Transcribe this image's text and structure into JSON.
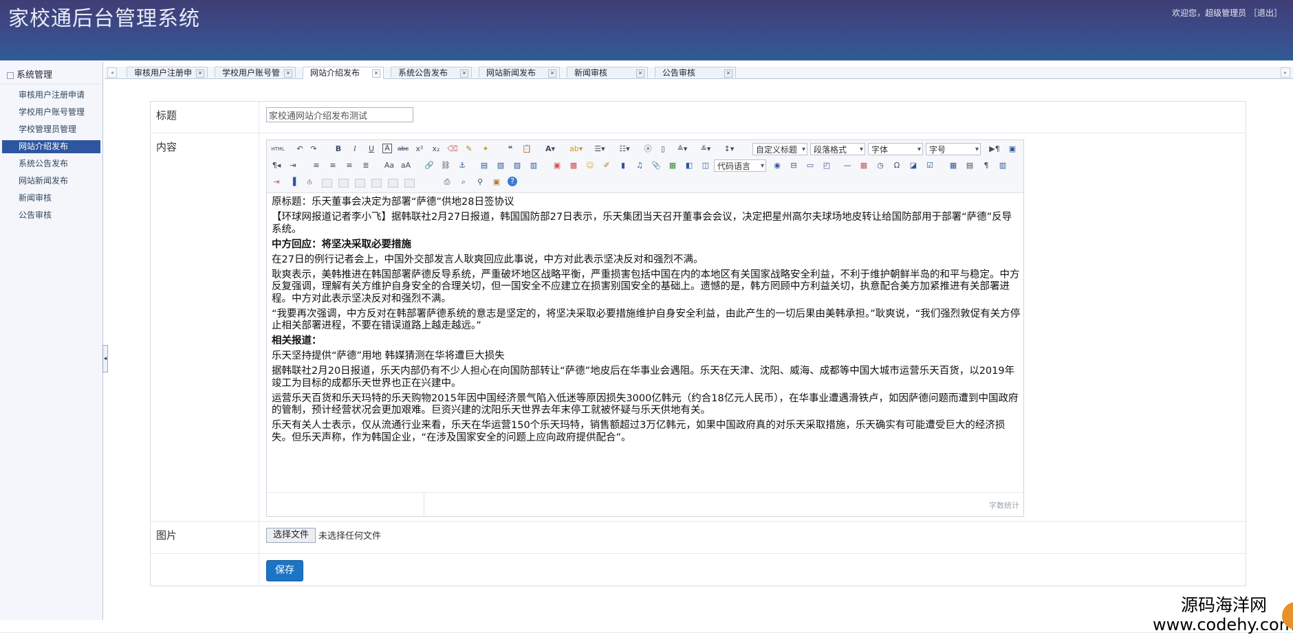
{
  "header": {
    "app_title": "家校通后台管理系统",
    "welcome": "欢迎您，超级管理员",
    "logout": "［退出］"
  },
  "sidebar": {
    "section_title": "系统管理",
    "items": [
      {
        "label": "审核用户注册申请"
      },
      {
        "label": "学校用户账号管理"
      },
      {
        "label": "学校管理员管理"
      },
      {
        "label": "网站介绍发布",
        "active": true
      },
      {
        "label": "系统公告发布"
      },
      {
        "label": "网站新闻发布"
      },
      {
        "label": "新闻审核"
      },
      {
        "label": "公告审核"
      }
    ]
  },
  "tabs": [
    {
      "label": "审核用户注册申"
    },
    {
      "label": "学校用户账号管"
    },
    {
      "label": "网站介绍发布",
      "active": true
    },
    {
      "label": "系统公告发布"
    },
    {
      "label": "网站新闻发布"
    },
    {
      "label": "新闻审核"
    },
    {
      "label": "公告审核"
    }
  ],
  "form": {
    "title_label": "标题",
    "title_value": "家校通网站介绍发布测试",
    "content_label": "内容",
    "image_label": "图片",
    "file_button": "选择文件",
    "file_status": "未选择任何文件",
    "save_button": "保存"
  },
  "editor": {
    "combos": {
      "custom_title": "自定义标题",
      "paragraph": "段落格式",
      "font": "字体",
      "size": "字号",
      "code": "代码语言"
    },
    "word_count": "字数统计",
    "paragraphs": [
      {
        "text": "原标题：乐天董事会决定为部署“萨德”供地28日签协议",
        "bold": false
      },
      {
        "text": "【环球网报道记者李小飞】据韩联社2月27日报道，韩国国防部27日表示，乐天集团当天召开董事会会议，决定把星州高尔夫球场地皮转让给国防部用于部署“萨德”反导系统。",
        "bold": false
      },
      {
        "text": "中方回应：将坚决采取必要措施",
        "bold": true
      },
      {
        "text": "在27日的例行记者会上，中国外交部发言人耿爽回应此事说，中方对此表示坚决反对和强烈不满。",
        "bold": false
      },
      {
        "text": "耿爽表示，美韩推进在韩国部署萨德反导系统，严重破坏地区战略平衡，严重损害包括中国在内的本地区有关国家战略安全利益，不利于维护朝鲜半岛的和平与稳定。中方反复强调，理解有关方维护自身安全的合理关切，但一国安全不应建立在损害别国安全的基础上。遗憾的是，韩方罔顾中方利益关切，执意配合美方加紧推进有关部署进程。中方对此表示坚决反对和强烈不满。",
        "bold": false
      },
      {
        "text": "“我要再次强调，中方反对在韩部署萨德系统的意志是坚定的，将坚决采取必要措施维护自身安全利益，由此产生的一切后果由美韩承担。”耿爽说，“我们强烈敦促有关方停止相关部署进程，不要在错误道路上越走越远。”",
        "bold": false
      },
      {
        "text": "相关报道：",
        "bold": true
      },
      {
        "text": "乐天坚持提供“萨德”用地 韩媒猜测在华将遭巨大损失",
        "bold": false
      },
      {
        "text": "据韩联社2月20日报道，乐天内部仍有不少人担心在向国防部转让“萨德”地皮后在华事业会遇阻。乐天在天津、沈阳、威海、成都等中国大城市运营乐天百货，以2019年竣工为目标的成都乐天世界也正在兴建中。",
        "bold": false
      },
      {
        "text": "运营乐天百货和乐天玛特的乐天购物2015年因中国经济景气陷入低迷等原因损失3000亿韩元（约合18亿元人民币），在华事业遭遇滑铁卢，如因萨德问题而遭到中国政府的管制，预计经营状况会更加艰难。巨资兴建的沈阳乐天世界去年末停工就被怀疑与乐天供地有关。",
        "bold": false
      },
      {
        "text": "乐天有关人士表示，仅从流通行业来看，乐天在华运营150个乐天玛特，销售额超过3万亿韩元，如果中国政府真的对乐天采取措施，乐天确实有可能遭受巨大的经济损失。但乐天声称，作为韩国企业，“在涉及国家安全的问题上应向政府提供配合”。",
        "bold": false
      }
    ]
  },
  "watermark": {
    "line1": "源码海洋网",
    "line2": "www.codehy.com"
  }
}
